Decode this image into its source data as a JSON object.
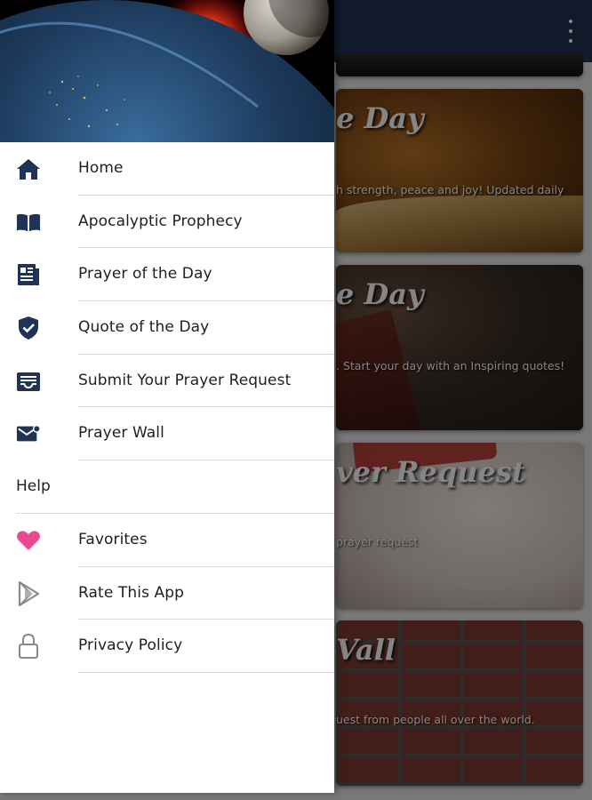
{
  "colors": {
    "appbar": "#1f3354",
    "icon_navy": "#1f3354",
    "heart_pink": "#e84a8f",
    "icon_grey": "#8a8a8a"
  },
  "background": {
    "cards": [
      {
        "title": "",
        "desc": ""
      },
      {
        "title": "e Day",
        "desc": "h strength, peace and joy! Updated daily"
      },
      {
        "title": "e Day",
        "desc": ". Start your day with an Inspiring quotes!"
      },
      {
        "title": "ver Request",
        "desc": "prayer request"
      },
      {
        "title": "Vall",
        "desc": "uest from people all over the world."
      }
    ]
  },
  "drawer": {
    "items": [
      {
        "label": "Home",
        "icon": "home-icon"
      },
      {
        "label": "Apocalyptic Prophecy",
        "icon": "open-book-icon"
      },
      {
        "label": "Prayer of the Day",
        "icon": "newspaper-icon"
      },
      {
        "label": "Quote of the Day",
        "icon": "verified-shield-icon"
      },
      {
        "label": "Submit Your Prayer Request",
        "icon": "inbox-tray-icon"
      },
      {
        "label": "Prayer Wall",
        "icon": "mail-icon"
      }
    ],
    "section_label": "Help",
    "help_items": [
      {
        "label": "Favorites",
        "icon": "heart-icon"
      },
      {
        "label": "Rate This App",
        "icon": "play-store-icon"
      },
      {
        "label": "Privacy Policy",
        "icon": "lock-icon"
      }
    ]
  }
}
